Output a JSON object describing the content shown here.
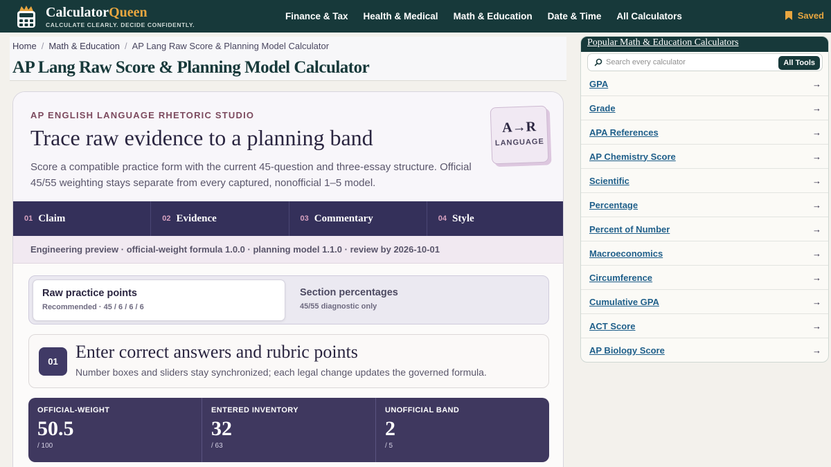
{
  "header": {
    "brand_main": "Calculator",
    "brand_accent": "Queen",
    "tagline": "CALCULATE CLEARLY. DECIDE CONFIDENTLY.",
    "nav": [
      "Finance & Tax",
      "Health & Medical",
      "Math & Education",
      "Date & Time",
      "All Calculators"
    ],
    "saved_label": "Saved"
  },
  "breadcrumb": [
    "Home",
    "Math & Education",
    "AP Lang Raw Score & Planning Model Calculator"
  ],
  "page_title": "AP Lang Raw Score & Planning Model Calculator",
  "hero": {
    "eyebrow": "AP ENGLISH LANGUAGE RHETORIC STUDIO",
    "title": "Trace raw evidence to a planning band",
    "description": "Score a compatible practice form with the current 45-question and three-essay structure. Official 45/55 weighting stays separate from every captured, nonofficial 1–5 model.",
    "badge_mark": "A→R",
    "badge_sub": "LANGUAGE"
  },
  "tabs": [
    {
      "num": "01",
      "label": "Claim"
    },
    {
      "num": "02",
      "label": "Evidence"
    },
    {
      "num": "03",
      "label": "Commentary"
    },
    {
      "num": "04",
      "label": "Style"
    }
  ],
  "meta_line": "Engineering preview · official-weight formula 1.0.0 · planning model 1.1.0 · review by 2026-10-01",
  "modes": {
    "active": {
      "title": "Raw practice points",
      "sub": "Recommended · 45 / 6 / 6 / 6"
    },
    "inactive": {
      "title": "Section percentages",
      "sub": "45/55 diagnostic only"
    }
  },
  "step": {
    "num": "01",
    "title": "Enter correct answers and rubric points",
    "desc": "Number boxes and sliders stay synchronized; each legal change updates the governed formula."
  },
  "stats": [
    {
      "label": "OFFICIAL-WEIGHT",
      "value": "50.5",
      "denom": "/ 100"
    },
    {
      "label": "ENTERED INVENTORY",
      "value": "32",
      "denom": "/ 63"
    },
    {
      "label": "UNOFFICIAL BAND",
      "value": "2",
      "denom": "/ 5"
    }
  ],
  "sidebar": {
    "title": "Popular Math & Education Calculators",
    "search_placeholder": "Search every calculator",
    "all_tools": "All Tools",
    "items": [
      "GPA",
      "Grade",
      "APA References",
      "AP Chemistry Score",
      "Scientific",
      "Percentage",
      "Percent of Number",
      "Macroeconomics",
      "Circumference",
      "Cumulative GPA",
      "ACT Score",
      "AP Biology Score"
    ],
    "arrow": "→"
  },
  "colors": {
    "header_bg": "#17393a",
    "accent": "#e8a640",
    "purple": "#34305a",
    "link": "#1f5f8a"
  }
}
